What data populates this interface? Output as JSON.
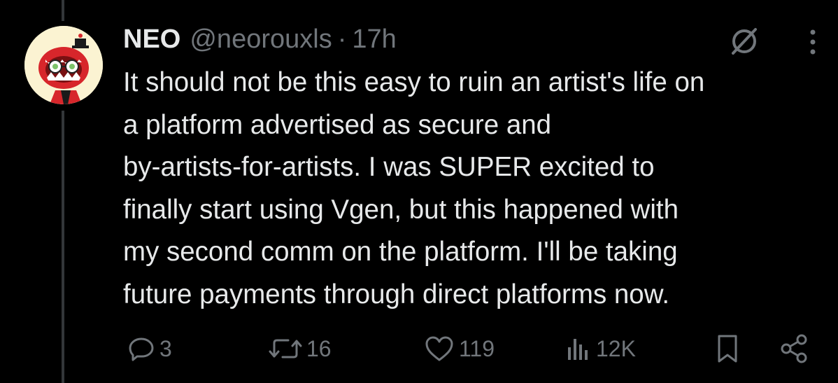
{
  "post": {
    "display_name": "NEO",
    "handle": "@neorouxls",
    "separator": "·",
    "time": "17h",
    "text": "It should not be this easy to ruin an artist's life on\na platform advertised as secure and\nby-artists-for-artists. I was SUPER excited to\nfinally start using Vgen, but this happened with\nmy second comm on the platform. I'll be taking\nfuture payments through direct platforms now."
  },
  "actions": {
    "replies": "3",
    "reposts": "16",
    "likes": "119",
    "views": "12K"
  },
  "icons": {
    "header": [
      "grok-icon",
      "more-options-icon"
    ],
    "actions": [
      "reply-icon",
      "repost-icon",
      "like-icon",
      "views-icon",
      "bookmark-icon",
      "share-icon"
    ]
  },
  "colors": {
    "background": "#000000",
    "text": "#e7e9ea",
    "muted": "#71767b",
    "thread_line": "#333639"
  }
}
